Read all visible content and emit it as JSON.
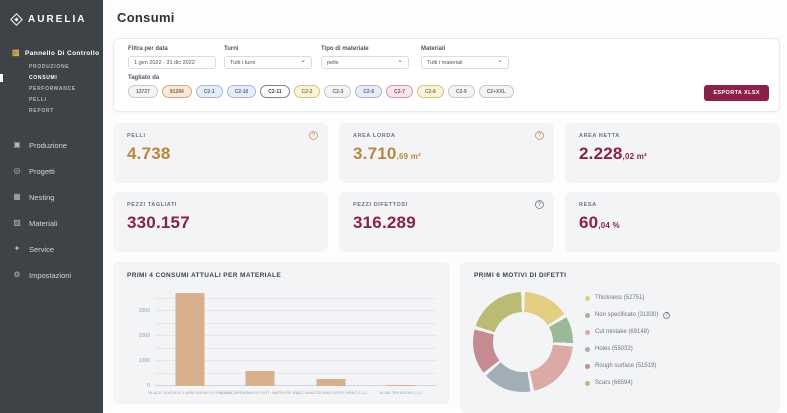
{
  "sidebar": {
    "logo_text": "AURELIA",
    "panel": {
      "label": "Pannello Di Controllo",
      "icon": "dashboard-icon"
    },
    "subitems": [
      {
        "label": "PRODUZIONE",
        "active": false
      },
      {
        "label": "CONSUMI",
        "active": true
      },
      {
        "label": "PERFORMANCE",
        "active": false
      },
      {
        "label": "PELLI",
        "active": false
      },
      {
        "label": "REPORT",
        "active": false
      }
    ],
    "items": [
      {
        "label": "Produzione",
        "icon": "production-icon"
      },
      {
        "label": "Progetti",
        "icon": "projects-icon"
      },
      {
        "label": "Nesting",
        "icon": "nesting-icon"
      },
      {
        "label": "Materiali",
        "icon": "materials-icon"
      },
      {
        "label": "Service",
        "icon": "service-icon"
      },
      {
        "label": "Impostazioni",
        "icon": "settings-icon"
      }
    ]
  },
  "header": {
    "title": "Consumi"
  },
  "filters": {
    "date": {
      "label": "Filtra per data",
      "value": "1 gen 2022 - 31 dic 2022"
    },
    "shifts": {
      "label": "Turni",
      "value": "Tutti i turni"
    },
    "material_type": {
      "label": "Tipo di materiale",
      "value": "pelle"
    },
    "materials": {
      "label": "Materiali",
      "value": "Tutti i materiali"
    },
    "cut_by_label": "Tagliato da",
    "chips": [
      {
        "label": "13727",
        "color": "gray"
      },
      {
        "label": "91284",
        "color": "tan"
      },
      {
        "label": "C2-1",
        "color": "blue"
      },
      {
        "label": "C2-10",
        "color": "blue"
      },
      {
        "label": "C2-11",
        "color": "selected"
      },
      {
        "label": "C2-2",
        "color": "yellow"
      },
      {
        "label": "C2-3",
        "color": "gray"
      },
      {
        "label": "C2-6",
        "color": "blue"
      },
      {
        "label": "C2-7",
        "color": "pink"
      },
      {
        "label": "C2-8",
        "color": "yellow"
      },
      {
        "label": "C2-9",
        "color": "gray"
      },
      {
        "label": "C2+XXL",
        "color": "gray"
      }
    ],
    "export_label": "ESPORTA XLSX"
  },
  "kpis": [
    {
      "label": "PELLI",
      "value": "4.738",
      "sub": "",
      "color": "gold",
      "help": true
    },
    {
      "label": "AREA LORDA",
      "value": "3.710",
      "sub": ",69 m²",
      "color": "gold",
      "help": true
    },
    {
      "label": "AREA NETTA",
      "value": "2.228",
      "sub": ",02 m²",
      "color": "maroon",
      "help": false
    },
    {
      "label": "PEZZI TAGLIATI",
      "value": "330.157",
      "sub": "",
      "color": "maroon",
      "help": false
    },
    {
      "label": "PEZZI DIFETTOSI",
      "value": "316.289",
      "sub": "",
      "color": "maroon",
      "help": true
    },
    {
      "label": "RESA",
      "value": "60",
      "sub": ",04 %",
      "color": "maroon",
      "help": false
    }
  ],
  "chart_data": [
    {
      "type": "bar",
      "title": "PRIMI 4 CONSUMI ATTUALI PER MATERIALE",
      "categories": [
        "BLACK LEATHER 1.4MM DRKW* LR PE 1.2.1",
        "ALMA CARRARMATO FATT. NAPPA PE 1.2.1",
        "FATT. AMAZON BIKE DROP NERO 1.2.1",
        "ALMA JPN AVION 1.2.1"
      ],
      "values": [
        3710,
        620,
        270,
        30
      ],
      "xlabel": "",
      "ylabel": "",
      "yticks": [
        0,
        1000,
        2000,
        3000
      ],
      "grid_step": 500,
      "grid_max": 3500,
      "ylim": [
        0,
        3840
      ],
      "bar_color": "#d8b08a",
      "legend_position": "none"
    },
    {
      "type": "pie",
      "title": "PRIMI 6 MOTIVI DI DIFETTI",
      "segments": [
        {
          "label": "Thickness",
          "value": 52751,
          "color": "#e3cd7e",
          "help": false
        },
        {
          "label": "Non specificato",
          "value": 31830,
          "color": "#9db894",
          "help": true
        },
        {
          "label": "Cut mistake",
          "value": 69148,
          "color": "#dcaaa4",
          "help": false
        },
        {
          "label": "Holes",
          "value": 55032,
          "color": "#a2aeb6",
          "help": false
        },
        {
          "label": "Rough surface",
          "value": 51519,
          "color": "#c58b8f",
          "help": false
        },
        {
          "label": "Scars",
          "value": 66594,
          "color": "#b9bc72",
          "help": false
        }
      ],
      "legend_position": "right"
    }
  ]
}
